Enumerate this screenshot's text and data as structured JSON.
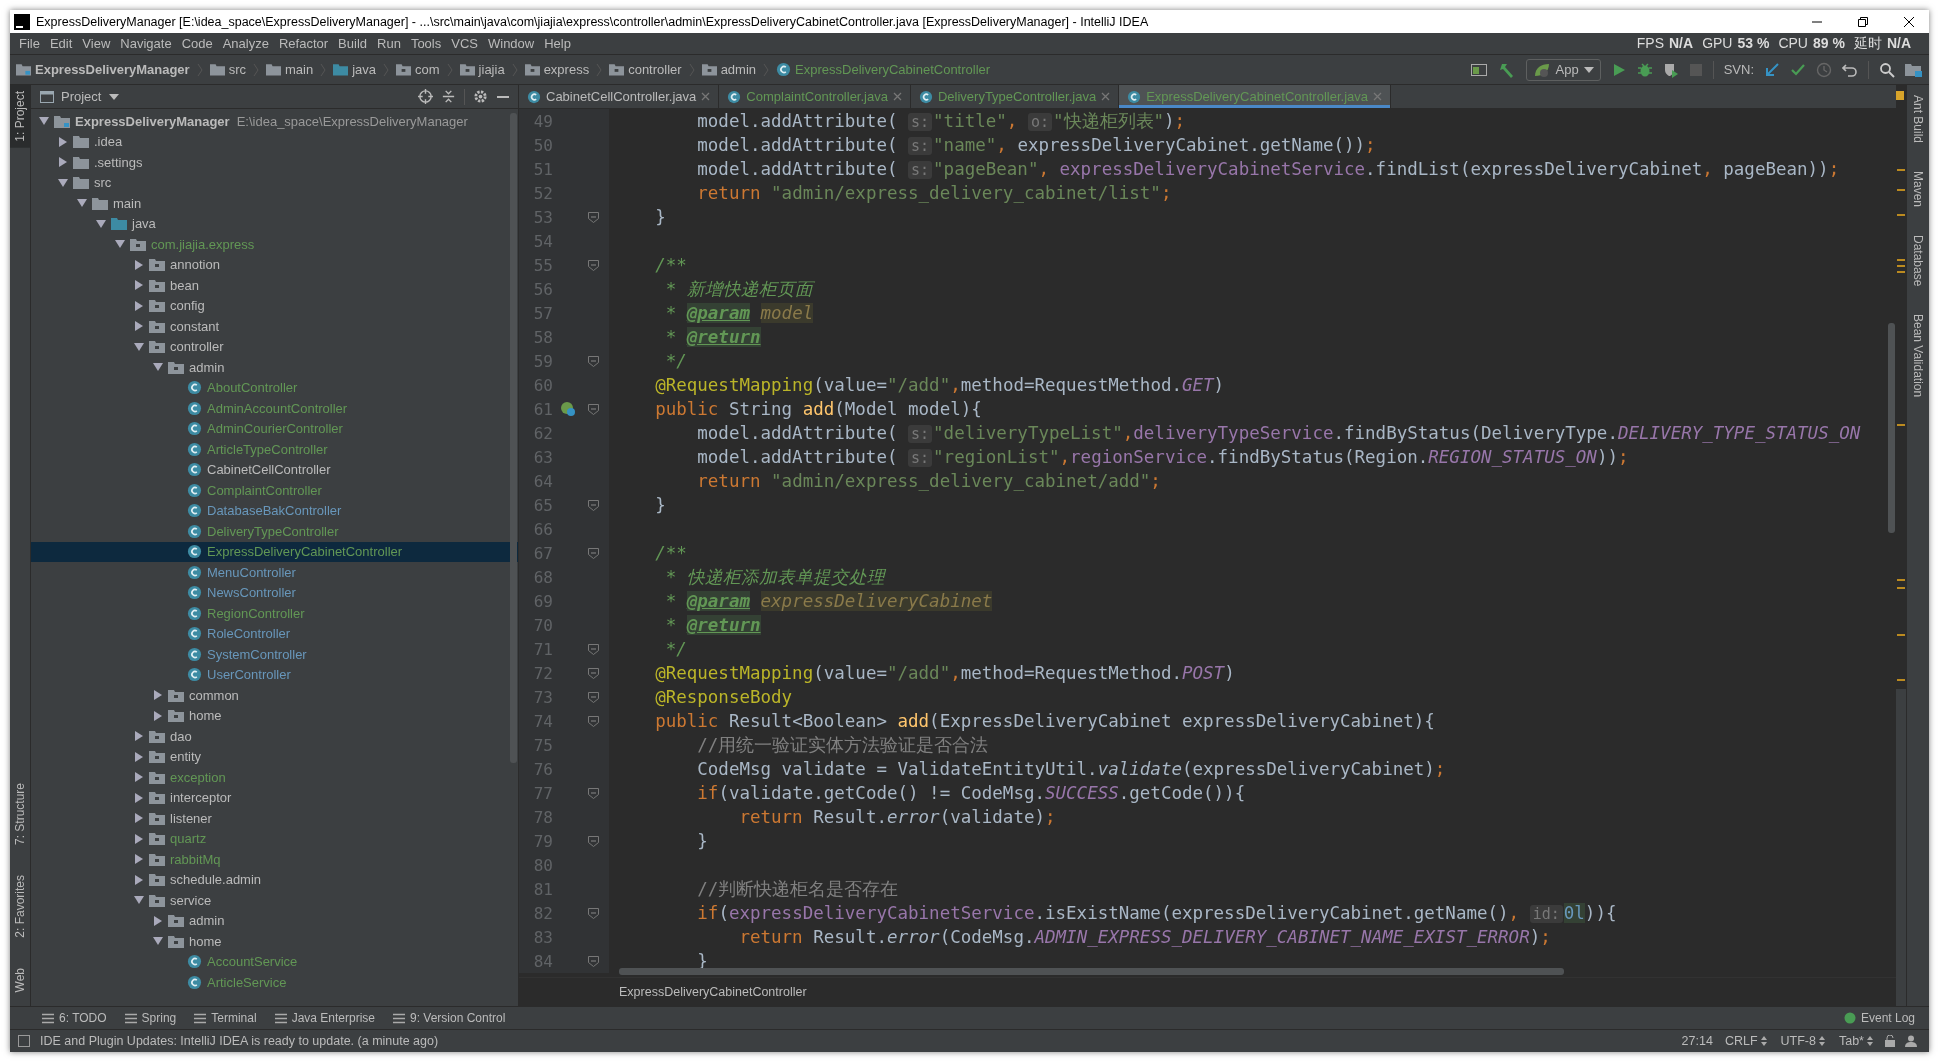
{
  "window": {
    "title": "ExpressDeliveryManager [E:\\idea_space\\ExpressDeliveryManager] - ...\\src\\main\\java\\com\\jiajia\\express\\controller\\admin\\ExpressDeliveryCabinetController.java [ExpressDeliveryManager] - IntelliJ IDEA"
  },
  "menu": [
    "File",
    "Edit",
    "View",
    "Navigate",
    "Code",
    "Analyze",
    "Refactor",
    "Build",
    "Run",
    "Tools",
    "VCS",
    "Window",
    "Help"
  ],
  "perf_indicator": [
    {
      "label": "FPS",
      "value": "N/A"
    },
    {
      "label": "GPU",
      "value": "53 %"
    },
    {
      "label": "CPU",
      "value": "89 %"
    },
    {
      "label": "延时",
      "value": "N/A"
    }
  ],
  "breadcrumb": [
    {
      "label": "ExpressDeliveryManager",
      "kind": "project"
    },
    {
      "label": "src",
      "kind": "folder"
    },
    {
      "label": "main",
      "kind": "folder"
    },
    {
      "label": "java",
      "kind": "source"
    },
    {
      "label": "com",
      "kind": "package"
    },
    {
      "label": "jiajia",
      "kind": "package"
    },
    {
      "label": "express",
      "kind": "package"
    },
    {
      "label": "controller",
      "kind": "package"
    },
    {
      "label": "admin",
      "kind": "package"
    },
    {
      "label": "ExpressDeliveryCabinetController",
      "kind": "class"
    }
  ],
  "toolbar": {
    "run_config": "App",
    "svn_label": "SVN:"
  },
  "left_tool_strip": [
    {
      "label": "1: Project",
      "selected": true
    },
    {
      "label": "7: Structure",
      "selected": false
    },
    {
      "label": "2: Favorites",
      "selected": false
    },
    {
      "label": "Web",
      "selected": false
    }
  ],
  "right_tool_strip": [
    "Ant Build",
    "Maven",
    "Database",
    "Bean Validation"
  ],
  "project_panel": {
    "title": "Project",
    "tree": [
      {
        "label": "ExpressDeliveryManager",
        "path": "E:\\idea_space\\ExpressDeliveryManager",
        "kind": "project",
        "expanded": true,
        "selected": false,
        "color": "#bbbbbb",
        "children": [
          {
            "label": ".idea",
            "kind": "folder",
            "expanded": false,
            "selected": false,
            "color": "#bbbbbb"
          },
          {
            "label": ".settings",
            "kind": "folder",
            "expanded": false,
            "selected": false,
            "color": "#bbbbbb"
          },
          {
            "label": "src",
            "kind": "folder",
            "expanded": true,
            "selected": false,
            "color": "#bbbbbb",
            "children": [
              {
                "label": "main",
                "kind": "folder",
                "expanded": true,
                "selected": false,
                "color": "#bbbbbb",
                "children": [
                  {
                    "label": "java",
                    "kind": "source",
                    "expanded": true,
                    "selected": false,
                    "color": "#bbbbbb",
                    "children": [
                      {
                        "label": "com.jiajia.express",
                        "kind": "package",
                        "expanded": true,
                        "selected": false,
                        "color": "#629755",
                        "children": [
                          {
                            "label": "annotion",
                            "kind": "package",
                            "expanded": false,
                            "selected": false,
                            "color": "#bbbbbb"
                          },
                          {
                            "label": "bean",
                            "kind": "package",
                            "expanded": false,
                            "selected": false,
                            "color": "#bbbbbb"
                          },
                          {
                            "label": "config",
                            "kind": "package",
                            "expanded": false,
                            "selected": false,
                            "color": "#bbbbbb"
                          },
                          {
                            "label": "constant",
                            "kind": "package",
                            "expanded": false,
                            "selected": false,
                            "color": "#bbbbbb"
                          },
                          {
                            "label": "controller",
                            "kind": "package",
                            "expanded": true,
                            "selected": false,
                            "color": "#bbbbbb",
                            "children": [
                              {
                                "label": "admin",
                                "kind": "package",
                                "expanded": true,
                                "selected": false,
                                "color": "#bbbbbb",
                                "children": [
                                  {
                                    "label": "AboutController",
                                    "kind": "class",
                                    "selected": false,
                                    "color": "#629755"
                                  },
                                  {
                                    "label": "AdminAccountController",
                                    "kind": "class",
                                    "selected": false,
                                    "color": "#629755"
                                  },
                                  {
                                    "label": "AdminCourierController",
                                    "kind": "class",
                                    "selected": false,
                                    "color": "#629755"
                                  },
                                  {
                                    "label": "ArticleTypeController",
                                    "kind": "class",
                                    "selected": false,
                                    "color": "#629755"
                                  },
                                  {
                                    "label": "CabinetCellController",
                                    "kind": "class",
                                    "selected": false,
                                    "color": "#bbbbbb"
                                  },
                                  {
                                    "label": "ComplaintController",
                                    "kind": "class",
                                    "selected": false,
                                    "color": "#629755"
                                  },
                                  {
                                    "label": "DatabaseBakController",
                                    "kind": "class",
                                    "selected": false,
                                    "color": "#6897bb"
                                  },
                                  {
                                    "label": "DeliveryTypeController",
                                    "kind": "class",
                                    "selected": false,
                                    "color": "#629755"
                                  },
                                  {
                                    "label": "ExpressDeliveryCabinetController",
                                    "kind": "class",
                                    "selected": true,
                                    "color": "#629755"
                                  },
                                  {
                                    "label": "MenuController",
                                    "kind": "class",
                                    "selected": false,
                                    "color": "#6897bb"
                                  },
                                  {
                                    "label": "NewsController",
                                    "kind": "class",
                                    "selected": false,
                                    "color": "#6897bb"
                                  },
                                  {
                                    "label": "RegionController",
                                    "kind": "class",
                                    "selected": false,
                                    "color": "#629755"
                                  },
                                  {
                                    "label": "RoleController",
                                    "kind": "class",
                                    "selected": false,
                                    "color": "#6897bb"
                                  },
                                  {
                                    "label": "SystemController",
                                    "kind": "class",
                                    "selected": false,
                                    "color": "#6897bb"
                                  },
                                  {
                                    "label": "UserController",
                                    "kind": "class",
                                    "selected": false,
                                    "color": "#6897bb"
                                  }
                                ]
                              },
                              {
                                "label": "common",
                                "kind": "package",
                                "expanded": false,
                                "selected": false,
                                "color": "#bbbbbb"
                              },
                              {
                                "label": "home",
                                "kind": "package",
                                "expanded": false,
                                "selected": false,
                                "color": "#bbbbbb"
                              }
                            ]
                          },
                          {
                            "label": "dao",
                            "kind": "package",
                            "expanded": false,
                            "selected": false,
                            "color": "#bbbbbb"
                          },
                          {
                            "label": "entity",
                            "kind": "package",
                            "expanded": false,
                            "selected": false,
                            "color": "#bbbbbb"
                          },
                          {
                            "label": "exception",
                            "kind": "package",
                            "expanded": false,
                            "selected": false,
                            "color": "#629755"
                          },
                          {
                            "label": "interceptor",
                            "kind": "package",
                            "expanded": false,
                            "selected": false,
                            "color": "#bbbbbb"
                          },
                          {
                            "label": "listener",
                            "kind": "package",
                            "expanded": false,
                            "selected": false,
                            "color": "#bbbbbb"
                          },
                          {
                            "label": "quartz",
                            "kind": "package",
                            "expanded": false,
                            "selected": false,
                            "color": "#629755"
                          },
                          {
                            "label": "rabbitMq",
                            "kind": "package",
                            "expanded": false,
                            "selected": false,
                            "color": "#629755"
                          },
                          {
                            "label": "schedule.admin",
                            "kind": "package",
                            "expanded": false,
                            "selected": false,
                            "color": "#bbbbbb"
                          },
                          {
                            "label": "service",
                            "kind": "package",
                            "expanded": true,
                            "selected": false,
                            "color": "#bbbbbb",
                            "children": [
                              {
                                "label": "admin",
                                "kind": "package",
                                "expanded": false,
                                "selected": false,
                                "color": "#bbbbbb"
                              },
                              {
                                "label": "home",
                                "kind": "package",
                                "expanded": true,
                                "selected": false,
                                "color": "#bbbbbb",
                                "children": [
                                  {
                                    "label": "AccountService",
                                    "kind": "class",
                                    "selected": false,
                                    "color": "#629755"
                                  },
                                  {
                                    "label": "ArticleService",
                                    "kind": "class",
                                    "selected": false,
                                    "color": "#629755"
                                  }
                                ]
                              }
                            ]
                          }
                        ]
                      }
                    ]
                  }
                ]
              }
            ]
          }
        ]
      }
    ]
  },
  "tabs": [
    {
      "label": "CabinetCellController.java",
      "selected": false,
      "color": "#bbbbbb"
    },
    {
      "label": "ComplaintController.java",
      "selected": false,
      "color": "#629755"
    },
    {
      "label": "DeliveryTypeController.java",
      "selected": false,
      "color": "#629755"
    },
    {
      "label": "ExpressDeliveryCabinetController.java",
      "selected": true,
      "color": "#629755"
    }
  ],
  "editor": {
    "lines": [
      {
        "number": "49",
        "fold_marker": false,
        "bean_marker": false,
        "tokens": [
          {
            "text": "        model.addAttribute( ",
            "kind": "plain"
          },
          {
            "text": "s:",
            "kind": "hint"
          },
          {
            "text": "\"title\"",
            "kind": "string"
          },
          {
            "text": ", ",
            "kind": "keyword"
          },
          {
            "text": "o:",
            "kind": "hint"
          },
          {
            "text": "\"快递柜列表\"",
            "kind": "string"
          },
          {
            "text": ")",
            "kind": "plain"
          },
          {
            "text": ";",
            "kind": "keyword"
          }
        ]
      },
      {
        "number": "50",
        "fold_marker": false,
        "bean_marker": false,
        "tokens": [
          {
            "text": "        model.addAttribute( ",
            "kind": "plain"
          },
          {
            "text": "s:",
            "kind": "hint"
          },
          {
            "text": "\"name\"",
            "kind": "string"
          },
          {
            "text": ", ",
            "kind": "keyword"
          },
          {
            "text": "expressDeliveryCabinet.getName())",
            "kind": "plain"
          },
          {
            "text": ";",
            "kind": "keyword"
          }
        ]
      },
      {
        "number": "51",
        "fold_marker": false,
        "bean_marker": false,
        "tokens": [
          {
            "text": "        model.addAttribute( ",
            "kind": "plain"
          },
          {
            "text": "s:",
            "kind": "hint"
          },
          {
            "text": "\"pageBean\"",
            "kind": "string"
          },
          {
            "text": ", ",
            "kind": "keyword"
          },
          {
            "text": "expressDeliveryCabinetService",
            "kind": "field"
          },
          {
            "text": ".findList(expressDeliveryCabinet",
            "kind": "plain"
          },
          {
            "text": ", ",
            "kind": "keyword"
          },
          {
            "text": "pageBean))",
            "kind": "plain"
          },
          {
            "text": ";",
            "kind": "keyword"
          }
        ]
      },
      {
        "number": "52",
        "fold_marker": false,
        "bean_marker": false,
        "tokens": [
          {
            "text": "        return ",
            "kind": "keyword"
          },
          {
            "text": "\"admin/express_delivery_cabinet/list\"",
            "kind": "string"
          },
          {
            "text": ";",
            "kind": "keyword"
          }
        ]
      },
      {
        "number": "53",
        "fold_marker": true,
        "bean_marker": false,
        "tokens": [
          {
            "text": "    }",
            "kind": "plain"
          }
        ]
      },
      {
        "number": "54",
        "fold_marker": false,
        "bean_marker": false
      },
      {
        "number": "55",
        "fold_marker": true,
        "bean_marker": false,
        "tokens": [
          {
            "text": "    /**",
            "kind": "doc"
          }
        ]
      },
      {
        "number": "56",
        "fold_marker": false,
        "bean_marker": false,
        "tokens": [
          {
            "text": "     * 新增快递柜页面",
            "kind": "doc"
          }
        ]
      },
      {
        "number": "57",
        "fold_marker": false,
        "bean_marker": false,
        "tokens": [
          {
            "text": "     * ",
            "kind": "doc"
          },
          {
            "text": "@param",
            "kind": "doctag"
          },
          {
            "text": " model",
            "kind": "docref"
          }
        ]
      },
      {
        "number": "58",
        "fold_marker": false,
        "bean_marker": false,
        "tokens": [
          {
            "text": "     * ",
            "kind": "doc"
          },
          {
            "text": "@return",
            "kind": "doctag"
          }
        ]
      },
      {
        "number": "59",
        "fold_marker": true,
        "bean_marker": false,
        "tokens": [
          {
            "text": "     */",
            "kind": "doc"
          }
        ]
      },
      {
        "number": "60",
        "fold_marker": false,
        "bean_marker": false,
        "tokens": [
          {
            "text": "    @RequestMapping",
            "kind": "annotation"
          },
          {
            "text": "(value=",
            "kind": "plain"
          },
          {
            "text": "\"/add\"",
            "kind": "string"
          },
          {
            "text": ",",
            "kind": "keyword"
          },
          {
            "text": "method=RequestMethod.",
            "kind": "plain"
          },
          {
            "text": "GET",
            "kind": "static"
          },
          {
            "text": ")",
            "kind": "plain"
          }
        ]
      },
      {
        "number": "61",
        "fold_marker": true,
        "bean_marker": true,
        "tokens": [
          {
            "text": "    public ",
            "kind": "keyword"
          },
          {
            "text": "String ",
            "kind": "plain"
          },
          {
            "text": "add",
            "kind": "method"
          },
          {
            "text": "(Model model){",
            "kind": "plain"
          }
        ]
      },
      {
        "number": "62",
        "fold_marker": false,
        "bean_marker": false,
        "tokens": [
          {
            "text": "        model.addAttribute( ",
            "kind": "plain"
          },
          {
            "text": "s:",
            "kind": "hint"
          },
          {
            "text": "\"deliveryTypeList\"",
            "kind": "string"
          },
          {
            "text": ",",
            "kind": "keyword"
          },
          {
            "text": "deliveryTypeService",
            "kind": "field"
          },
          {
            "text": ".findByStatus(DeliveryType.",
            "kind": "plain"
          },
          {
            "text": "DELIVERY_TYPE_STATUS_ON",
            "kind": "static"
          }
        ]
      },
      {
        "number": "63",
        "fold_marker": false,
        "bean_marker": false,
        "tokens": [
          {
            "text": "        model.addAttribute( ",
            "kind": "plain"
          },
          {
            "text": "s:",
            "kind": "hint"
          },
          {
            "text": "\"regionList\"",
            "kind": "string"
          },
          {
            "text": ",",
            "kind": "keyword"
          },
          {
            "text": "regionService",
            "kind": "field"
          },
          {
            "text": ".findByStatus(Region.",
            "kind": "plain"
          },
          {
            "text": "REGION_STATUS_ON",
            "kind": "static"
          },
          {
            "text": "))",
            "kind": "plain"
          },
          {
            "text": ";",
            "kind": "keyword"
          }
        ]
      },
      {
        "number": "64",
        "fold_marker": false,
        "bean_marker": false,
        "tokens": [
          {
            "text": "        return ",
            "kind": "keyword"
          },
          {
            "text": "\"admin/express_delivery_cabinet/add\"",
            "kind": "string"
          },
          {
            "text": ";",
            "kind": "keyword"
          }
        ]
      },
      {
        "number": "65",
        "fold_marker": true,
        "bean_marker": false,
        "tokens": [
          {
            "text": "    }",
            "kind": "plain"
          }
        ]
      },
      {
        "number": "66",
        "fold_marker": false,
        "bean_marker": false
      },
      {
        "number": "67",
        "fold_marker": true,
        "bean_marker": false,
        "tokens": [
          {
            "text": "    /**",
            "kind": "doc"
          }
        ]
      },
      {
        "number": "68",
        "fold_marker": false,
        "bean_marker": false,
        "tokens": [
          {
            "text": "     * 快递柜添加表单提交处理",
            "kind": "doc"
          }
        ]
      },
      {
        "number": "69",
        "fold_marker": false,
        "bean_marker": false,
        "tokens": [
          {
            "text": "     * ",
            "kind": "doc"
          },
          {
            "text": "@param",
            "kind": "doctag"
          },
          {
            "text": " expressDeliveryCabinet",
            "kind": "docref"
          }
        ]
      },
      {
        "number": "70",
        "fold_marker": false,
        "bean_marker": false,
        "tokens": [
          {
            "text": "     * ",
            "kind": "doc"
          },
          {
            "text": "@return",
            "kind": "doctag"
          }
        ]
      },
      {
        "number": "71",
        "fold_marker": true,
        "bean_marker": false,
        "tokens": [
          {
            "text": "     */",
            "kind": "doc"
          }
        ]
      },
      {
        "number": "72",
        "fold_marker": true,
        "bean_marker": false,
        "tokens": [
          {
            "text": "    @RequestMapping",
            "kind": "annotation"
          },
          {
            "text": "(value=",
            "kind": "plain"
          },
          {
            "text": "\"/add\"",
            "kind": "string"
          },
          {
            "text": ",",
            "kind": "keyword"
          },
          {
            "text": "method=RequestMethod.",
            "kind": "plain"
          },
          {
            "text": "POST",
            "kind": "static"
          },
          {
            "text": ")",
            "kind": "plain"
          }
        ]
      },
      {
        "number": "73",
        "fold_marker": true,
        "bean_marker": false,
        "tokens": [
          {
            "text": "    @ResponseBody",
            "kind": "annotation"
          }
        ]
      },
      {
        "number": "74",
        "fold_marker": true,
        "bean_marker": false,
        "tokens": [
          {
            "text": "    public ",
            "kind": "keyword"
          },
          {
            "text": "Result<Boolean> ",
            "kind": "plain"
          },
          {
            "text": "add",
            "kind": "method"
          },
          {
            "text": "(ExpressDeliveryCabinet expressDeliveryCabinet){",
            "kind": "plain"
          }
        ]
      },
      {
        "number": "75",
        "fold_marker": false,
        "bean_marker": false,
        "tokens": [
          {
            "text": "        //用统一验证实体方法验证是否合法",
            "kind": "comment"
          }
        ]
      },
      {
        "number": "76",
        "fold_marker": false,
        "bean_marker": false,
        "tokens": [
          {
            "text": "        CodeMsg validate = ValidateEntityUtil.",
            "kind": "plain"
          },
          {
            "text": "validate",
            "kind": "call"
          },
          {
            "text": "(expressDeliveryCabinet)",
            "kind": "plain"
          },
          {
            "text": ";",
            "kind": "keyword"
          }
        ]
      },
      {
        "number": "77",
        "fold_marker": true,
        "bean_marker": false,
        "tokens": [
          {
            "text": "        if",
            "kind": "keyword"
          },
          {
            "text": "(validate.getCode() != CodeMsg.",
            "kind": "plain"
          },
          {
            "text": "SUCCESS",
            "kind": "static"
          },
          {
            "text": ".getCode()){",
            "kind": "plain"
          }
        ]
      },
      {
        "number": "78",
        "fold_marker": false,
        "bean_marker": false,
        "tokens": [
          {
            "text": "            return ",
            "kind": "keyword"
          },
          {
            "text": "Result.",
            "kind": "plain"
          },
          {
            "text": "error",
            "kind": "call"
          },
          {
            "text": "(validate)",
            "kind": "plain"
          },
          {
            "text": ";",
            "kind": "keyword"
          }
        ]
      },
      {
        "number": "79",
        "fold_marker": true,
        "bean_marker": false,
        "tokens": [
          {
            "text": "        }",
            "kind": "plain"
          }
        ]
      },
      {
        "number": "80",
        "fold_marker": false,
        "bean_marker": false
      },
      {
        "number": "81",
        "fold_marker": false,
        "bean_marker": false,
        "tokens": [
          {
            "text": "        //判断快递柜名是否存在",
            "kind": "comment"
          }
        ]
      },
      {
        "number": "82",
        "fold_marker": true,
        "bean_marker": false,
        "tokens": [
          {
            "text": "        if",
            "kind": "keyword"
          },
          {
            "text": "(",
            "kind": "plain"
          },
          {
            "text": "expressDeliveryCabinetService",
            "kind": "field"
          },
          {
            "text": ".isExistName(expressDeliveryCabinet.getName()",
            "kind": "plain"
          },
          {
            "text": ", ",
            "kind": "keyword"
          },
          {
            "text": "id:",
            "kind": "hint"
          },
          {
            "text": "0l",
            "kind": "number"
          },
          {
            "text": ")){",
            "kind": "plain"
          }
        ]
      },
      {
        "number": "83",
        "fold_marker": false,
        "bean_marker": false,
        "tokens": [
          {
            "text": "            return ",
            "kind": "keyword"
          },
          {
            "text": "Result.",
            "kind": "plain"
          },
          {
            "text": "error",
            "kind": "call"
          },
          {
            "text": "(CodeMsg.",
            "kind": "plain"
          },
          {
            "text": "ADMIN_EXPRESS_DELIVERY_CABINET_NAME_EXIST_ERROR",
            "kind": "static"
          },
          {
            "text": ")",
            "kind": "plain"
          },
          {
            "text": ";",
            "kind": "keyword"
          }
        ]
      },
      {
        "number": "84",
        "fold_marker": true,
        "bean_marker": false,
        "tokens": [
          {
            "text": "        }",
            "kind": "plain"
          }
        ]
      }
    ],
    "breadcrumb": "ExpressDeliveryCabinetController"
  },
  "bottom_tool_tabs": [
    "6: TODO",
    "Spring",
    "Terminal",
    "Java Enterprise",
    "9: Version Control"
  ],
  "event_log": "Event Log",
  "status_bar": {
    "message": "IDE and Plugin Updates: IntelliJ IDEA is ready to update. (a minute ago)",
    "position": "27:14",
    "line_separator": "CRLF",
    "encoding": "UTF-8",
    "indent": "Tab*"
  }
}
